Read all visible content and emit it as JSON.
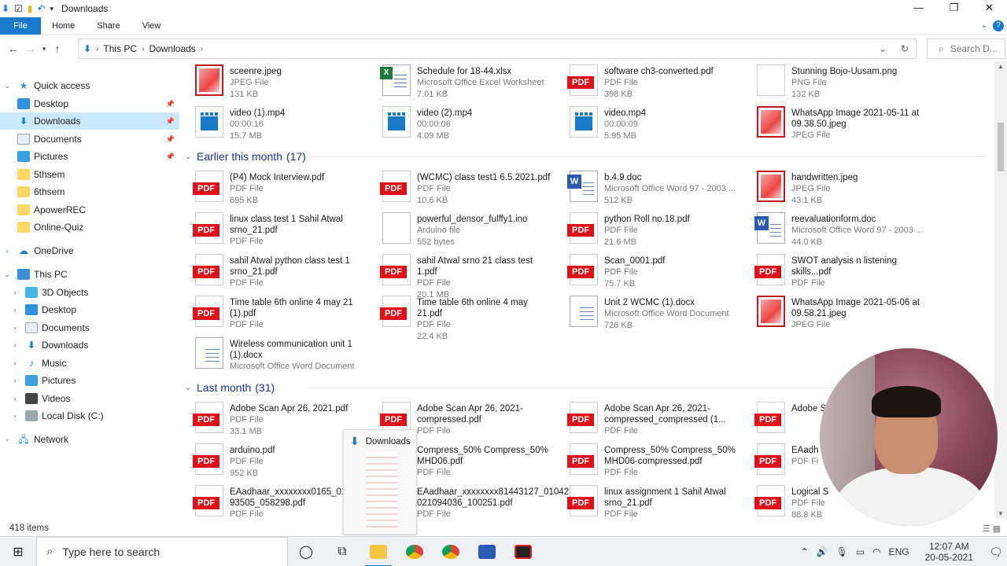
{
  "window": {
    "title": "Downloads"
  },
  "controls": {
    "minimize": "—",
    "restore": "❐",
    "close": "✕"
  },
  "ribbon": {
    "file": "File",
    "home": "Home",
    "share": "Share",
    "view": "View"
  },
  "address": {
    "crumbs": [
      "This PC",
      "Downloads"
    ],
    "refresh": "↻"
  },
  "search": {
    "placeholder": "Search D..."
  },
  "sidebar": {
    "quick_access": "Quick access",
    "pinned": [
      "Desktop",
      "Downloads",
      "Documents",
      "Pictures"
    ],
    "folders": [
      "5thsem",
      "6thsem",
      "ApowerREC",
      "Online-Quiz"
    ],
    "onedrive": "OneDrive",
    "this_pc": "This PC",
    "pc_items": [
      "3D Objects",
      "Desktop",
      "Documents",
      "Downloads",
      "Music",
      "Pictures",
      "Videos",
      "Local Disk (C:)"
    ],
    "network": "Network"
  },
  "groups": [
    {
      "title": "",
      "count": "",
      "files": [
        {
          "name": "sceenre.jpeg",
          "type": "JPEG File",
          "size": "131 KB",
          "icon": "jpeg"
        },
        {
          "name": "Schedule for 18-44.xlsx",
          "type": "Microsoft Office Excel Worksheet",
          "size": "7.01 KB",
          "icon": "xlsx"
        },
        {
          "name": "software ch3-converted.pdf",
          "type": "PDF File",
          "size": "398 KB",
          "icon": "pdf"
        },
        {
          "name": "Stunning Bojo-Uusam.png",
          "type": "PNG File",
          "size": "132 KB",
          "icon": "png"
        },
        {
          "name": "video (1).mp4",
          "type": "00:00:16",
          "size": "15.7 MB",
          "icon": "mp4"
        },
        {
          "name": "video (2).mp4",
          "type": "00:00:06",
          "size": "4.09 MB",
          "icon": "mp4"
        },
        {
          "name": "video.mp4",
          "type": "00:00:09",
          "size": "5.95 MB",
          "icon": "mp4"
        },
        {
          "name": "WhatsApp Image 2021-05-11 at 09.38.50.jpeg",
          "type": "JPEG File",
          "size": "",
          "icon": "jpeg"
        }
      ]
    },
    {
      "title": "Earlier this month",
      "count": "(17)",
      "files": [
        {
          "name": "(P4) Mock Interview.pdf",
          "type": "PDF File",
          "size": "695 KB",
          "icon": "pdf"
        },
        {
          "name": "(WCMC) class test1 6.5.2021.pdf",
          "type": "PDF File",
          "size": "10.6 KB",
          "icon": "pdf"
        },
        {
          "name": "b.4.9.doc",
          "type": "Microsoft Office Word 97 - 2003 ...",
          "size": "512 KB",
          "icon": "doc"
        },
        {
          "name": "handwritten.jpeg",
          "type": "JPEG File",
          "size": "43.1 KB",
          "icon": "jpeg"
        },
        {
          "name": "linux class test 1 Sahil Atwal srno_21.pdf",
          "type": "PDF File",
          "size": "",
          "icon": "pdf"
        },
        {
          "name": "powerful_densor_fulffy1.ino",
          "type": "Arduino file",
          "size": "552 bytes",
          "icon": "blank"
        },
        {
          "name": "python Roll no.18.pdf",
          "type": "PDF File",
          "size": "21.6 MB",
          "icon": "pdf"
        },
        {
          "name": "reevaluationform.doc",
          "type": "Microsoft Office Word 97 - 2003 ...",
          "size": "44.0 KB",
          "icon": "doc"
        },
        {
          "name": "sahil Atwal python class test 1 srno_21.pdf",
          "type": "PDF File",
          "size": "",
          "icon": "pdf"
        },
        {
          "name": "sahil Atwal srno 21 class test 1.pdf",
          "type": "PDF File",
          "size": "20.1 MB",
          "icon": "pdf"
        },
        {
          "name": "Scan_0001.pdf",
          "type": "PDF File",
          "size": "75.7 KB",
          "icon": "pdf"
        },
        {
          "name": "SWOT analysis n listening skills...pdf",
          "type": "PDF File",
          "size": "",
          "icon": "pdf"
        },
        {
          "name": "Time table 6th online 4 may 21 (1).pdf",
          "type": "PDF File",
          "size": "",
          "icon": "pdf"
        },
        {
          "name": "Time table 6th online 4 may 21.pdf",
          "type": "PDF File",
          "size": "22.4 KB",
          "icon": "pdf"
        },
        {
          "name": "Unit 2 WCMC (1).docx",
          "type": "Microsoft Office Word Document",
          "size": "726 KB",
          "icon": "docx"
        },
        {
          "name": "WhatsApp Image 2021-05-06 at 09.58.21.jpeg",
          "type": "JPEG File",
          "size": "",
          "icon": "jpeg"
        },
        {
          "name": "Wireless communication unit 1 (1).docx",
          "type": "Microsoft Office Word Document",
          "size": "",
          "icon": "docx"
        }
      ]
    },
    {
      "title": "Last month",
      "count": "(31)",
      "files": [
        {
          "name": "Adobe Scan Apr 26, 2021.pdf",
          "type": "PDF File",
          "size": "33.1 MB",
          "icon": "pdf"
        },
        {
          "name": "Adobe Scan Apr 26, 2021-compressed.pdf",
          "type": "PDF File",
          "size": "",
          "icon": "pdf"
        },
        {
          "name": "Adobe Scan Apr 26, 2021-compressed_compressed (1...",
          "type": "PDF File",
          "size": "",
          "icon": "pdf"
        },
        {
          "name": "Adobe S 2021-c",
          "type": "",
          "size": "",
          "icon": "pdf"
        },
        {
          "name": "arduino.pdf",
          "type": "PDF File",
          "size": "952 KB",
          "icon": "pdf"
        },
        {
          "name": "Compress_50% Compress_50% MHD06.pdf",
          "type": "PDF File",
          "size": "",
          "icon": "pdf"
        },
        {
          "name": "Compress_50% Compress_50% MHD06-compressed.pdf",
          "type": "PDF File",
          "size": "",
          "icon": "pdf"
        },
        {
          "name": "EAadh 83457",
          "type": "PDF Fi",
          "size": "",
          "icon": "pdf"
        },
        {
          "name": "EAadhaar_xxxxxxxx0165_010 93505_058298.pdf",
          "type": "PDF File",
          "size": "",
          "icon": "pdf"
        },
        {
          "name": "EAadhaar_xxxxxxxx81443127_01042 021094036_100251.pdf",
          "type": "PDF File",
          "size": "",
          "icon": "pdf"
        },
        {
          "name": "linux assignment 1 Sahil Atwal srno_21.pdf",
          "type": "PDF File",
          "size": "",
          "icon": "pdf"
        },
        {
          "name": "Logical S",
          "type": "PDF File",
          "size": "88.8 KB",
          "icon": "pdf"
        }
      ]
    }
  ],
  "status": {
    "count": "418 items"
  },
  "drag": {
    "label": "Downloads"
  },
  "taskbar": {
    "search_placeholder": "Type here to search",
    "lang": "ENG",
    "time": "12:07 AM",
    "date": "20-05-2021"
  }
}
